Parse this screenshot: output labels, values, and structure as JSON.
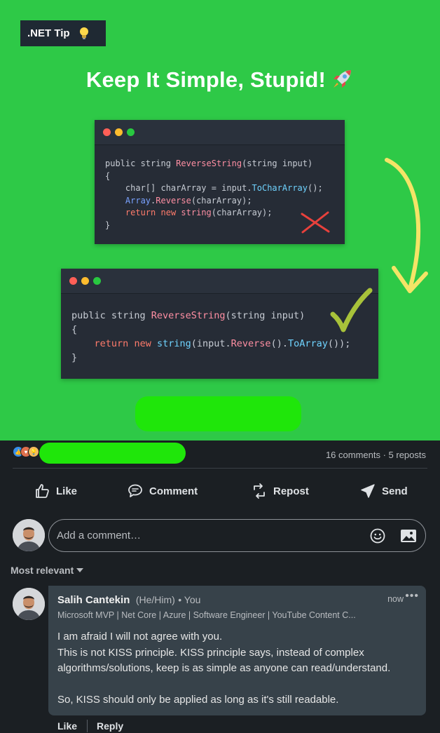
{
  "post_image": {
    "badge": ".NET Tip",
    "headline": "Keep It Simple, Stupid!",
    "code_before": {
      "line1_a": "public string ",
      "line1_fn": "ReverseString",
      "line1_b": "(string input)",
      "line2": "{",
      "line3_a": "    char[] charArray = input.",
      "line3_fn": "ToCharArray",
      "line3_b": "();",
      "line4_type": "Array",
      "line4_a": ".",
      "line4_fn": "Reverse",
      "line4_b": "(charArray);",
      "line5_kw1": "return",
      "line5_kw2": "new",
      "line5_a": "string",
      "line5_b": "(charArray);",
      "line6": "}"
    },
    "code_after": {
      "line1_a": "public string ",
      "line1_fn": "ReverseString",
      "line1_b": "(string input)",
      "line2": "{",
      "line3_kw1": "return",
      "line3_kw2": "new",
      "line3_a": "string",
      "line3_b": "(input.",
      "line3_fn1": "Reverse",
      "line3_c": "().",
      "line3_fn2": "ToArray",
      "line3_d": "());",
      "line4": "}"
    }
  },
  "social": {
    "counts": "16 comments · 5 reposts"
  },
  "actions": {
    "like": "Like",
    "comment": "Comment",
    "repost": "Repost",
    "send": "Send"
  },
  "add_comment": {
    "placeholder": "Add a comment…"
  },
  "sort": {
    "label": "Most relevant"
  },
  "comment": {
    "author": "Salih Cantekin",
    "pronouns": "(He/Him)",
    "relation": "• You",
    "headline": "Microsoft MVP | Net Core | Azure | Software Engineer | YouTube Content C...",
    "time": "now",
    "more": "•••",
    "lines": [
      "I am afraid I will not agree with you.",
      "This is not KISS principle. KISS principle says, instead of complex algorithms/solutions, keep is as simple as anyone can read/understand.",
      "",
      "So, KISS should only be applied as long as it's still readable."
    ],
    "like": "Like",
    "reply": "Reply"
  },
  "colors": {
    "card_green": "#2ec947",
    "background": "#1b1f23",
    "bubble": "#37424a"
  }
}
